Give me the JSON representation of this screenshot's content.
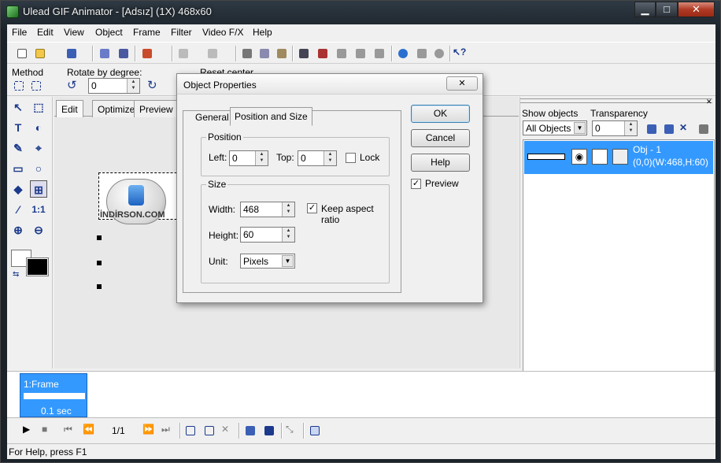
{
  "window": {
    "title": "Ulead GIF Animator - [Adsız] (1X) 468x60",
    "min": "▁",
    "max": "□",
    "close": "✕"
  },
  "menu": [
    "File",
    "Edit",
    "View",
    "Object",
    "Frame",
    "Filter",
    "Video F/X",
    "Help"
  ],
  "subbar": {
    "method_label": "Method",
    "rotate_label": "Rotate by degree:",
    "rotate_value": "0",
    "reset_label": "Reset center"
  },
  "tabs": [
    "Edit",
    "Optimize",
    "Preview"
  ],
  "watermark": "İNDİRSON.COM",
  "objects_panel": {
    "show_label": "Show objects",
    "show_value": "All Objects",
    "transparency_label": "Transparency",
    "transparency_value": "0",
    "obj_name": "Obj - 1",
    "obj_info": "(0,0)(W:468,H:60)"
  },
  "frames": [
    {
      "name": "1:Frame",
      "delay": "0.1 sec"
    }
  ],
  "playbar": {
    "counter": "1/1"
  },
  "status": "For Help, press F1",
  "dialog": {
    "title": "Object Properties",
    "close": "✕",
    "tabs": [
      "General",
      "Position and Size"
    ],
    "position": {
      "group": "Position",
      "left_label": "Left:",
      "left_value": "0",
      "top_label": "Top:",
      "top_value": "0",
      "lock_label": "Lock"
    },
    "size": {
      "group": "Size",
      "width_label": "Width:",
      "width_value": "468",
      "height_label": "Height:",
      "height_value": "60",
      "keep_label": "Keep aspect ratio",
      "unit_label": "Unit:",
      "unit_value": "Pixels"
    },
    "buttons": {
      "ok": "OK",
      "cancel": "Cancel",
      "help": "Help"
    },
    "preview_label": "Preview"
  },
  "colors": {
    "selection": "#3399ff",
    "titlebar": "#1b2229",
    "close": "#c24a33"
  }
}
